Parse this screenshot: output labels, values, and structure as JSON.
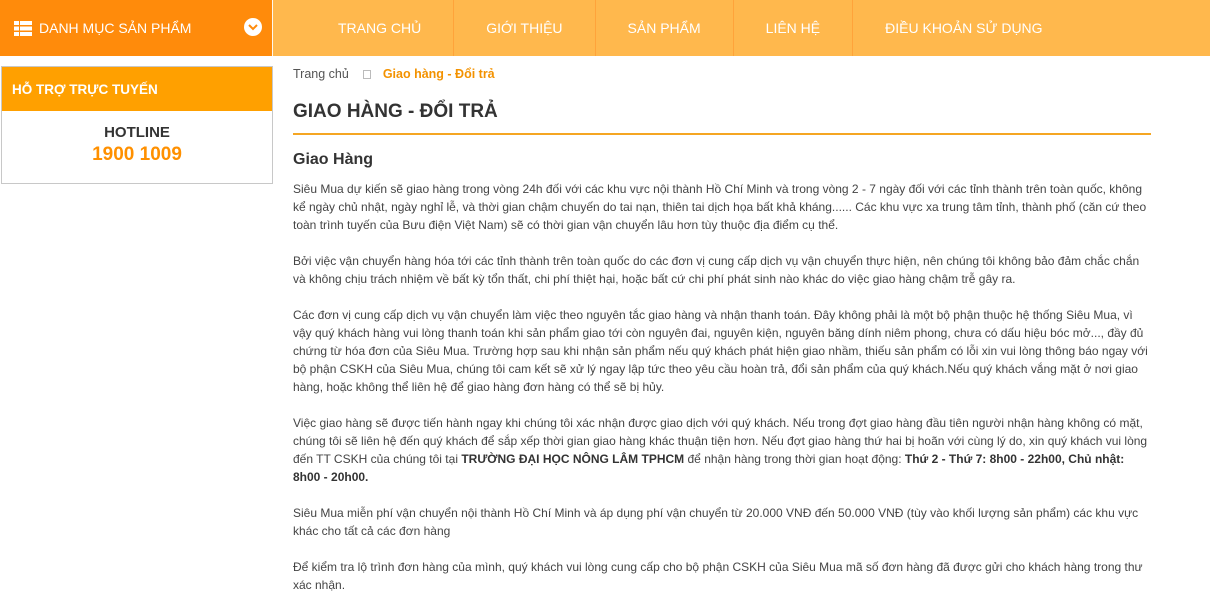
{
  "header": {
    "category_menu_label": "DANH MỤC SẢN PHẨM",
    "nav_items": [
      "TRANG CHỦ",
      "GIỚI THIỆU",
      "SẢN PHẨM",
      "LIÊN HỆ",
      "ĐIỀU KHOẢN SỬ DỤNG"
    ]
  },
  "sidebar": {
    "support_title": "HỖ TRỢ TRỰC TUYẾN",
    "hotline_label": "HOTLINE",
    "hotline_number": "1900 1009"
  },
  "breadcrumb": {
    "home": "Trang chủ",
    "current": "Giao hàng - Đổi trả"
  },
  "page_title": "GIAO HÀNG - ĐỔI TRẢ",
  "section_title": "Giao Hàng",
  "paragraphs": {
    "p1": "Siêu Mua dự kiến sẽ giao hàng trong vòng 24h  đối với các khu vực nội thành Hồ Chí Minh và trong vòng 2 - 7 ngày đối với các tỉnh thành trên toàn quốc, không kể ngày chủ nhật, ngày nghỉ lễ, và thời gian chậm chuyến do tai nạn, thiên tai dịch họa bất khả kháng...... Các khu vực xa trung tâm tỉnh, thành phố (căn cứ theo toàn trình tuyến của Bưu điện Việt Nam) sẽ có thời gian vận chuyển lâu hơn tùy thuộc địa điểm cụ thể.",
    "p2": "Bởi việc vận chuyển hàng hóa tới các tỉnh thành trên toàn quốc do các đơn vị cung cấp dịch vụ vận chuyển thực hiện, nên chúng tôi không bảo đảm chắc chắn và không chịu trách nhiệm về bất kỳ tổn thất, chi phí thiệt hại, hoặc bất cứ chi phí phát sinh nào khác do việc giao hàng chậm trễ gây ra.",
    "p3": "Các đơn vị cung cấp dịch vụ vận chuyển làm việc theo nguyên tắc giao hàng và nhận thanh toán. Đây không phải là một bộ phận thuộc hệ thống Siêu Mua, vì vậy quý khách hàng vui lòng thanh toán khi sản phẩm giao tới còn nguyên đai, nguyên kiện, nguyên băng dính niêm phong, chưa có dấu hiệu bóc mở..., đầy đủ chứng từ hóa đơn của Siêu Mua. Trường hợp sau khi nhận sản phẩm nếu quý khách phát hiện giao nhầm, thiếu sản phẩm có lỗi xin vui lòng thông báo ngay với bộ phận CSKH của Siêu Mua, chúng tôi cam kết sẽ xử lý ngay lập tức theo yêu cầu hoàn trả, đổi sản phẩm của quý khách.Nếu quý khách vắng mặt ở nơi giao hàng, hoặc không thể liên hệ để giao hàng đơn hàng có thể sẽ bị hủy.",
    "p4_part1": "Việc giao hàng sẽ được tiến hành ngay khi chúng tôi xác nhận được giao dịch với quý khách. Nếu trong đợt giao hàng đầu tiên người nhận hàng không có mặt, chúng tôi sẽ liên hệ đến quý khách để sắp xếp thời gian giao hàng khác thuận tiện hơn. Nếu đợt giao hàng thứ hai bị hoãn với cùng lý do, xin quý khách vui lòng đến TT CSKH của chúng tôi tại ",
    "p4_bold1": "TRƯỜNG ĐẠI HỌC NÔNG LÂM TPHCM",
    "p4_part2": " để nhận hàng trong thời gian hoạt động: ",
    "p4_bold2": "Thứ 2 - Thứ 7: 8h00 - 22h00, Chủ nhật: 8h00 - 20h00.",
    "p5": "Siêu Mua miễn phí vận chuyển nội thành Hồ Chí Minh và áp dụng phí vận chuyển từ 20.000 VNĐ đến 50.000 VNĐ (tùy vào khối lượng sản phẩm) các khu vực khác cho tất cả các đơn hàng",
    "p6": "Để kiểm tra lộ trình đơn hàng của mình, quý khách vui lòng cung cấp cho bộ phận CSKH của Siêu Mua mã số đơn hàng đã được gửi cho khách hàng trong thư xác nhận."
  },
  "colors": {
    "nav_bg": "#ffb84d",
    "category_bg": "#ff8b0b",
    "accent": "#f39200",
    "support_head_bg": "#ffa000"
  },
  "icons": [
    "grid-list-icon",
    "chevron-down-icon",
    "breadcrumb-separator-icon"
  ]
}
